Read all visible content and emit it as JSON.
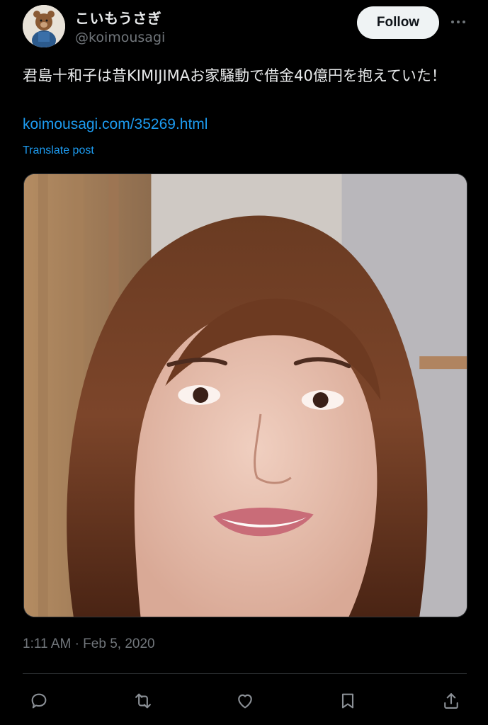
{
  "author": {
    "display_name": "こいもうさぎ",
    "handle": "@koimousagi"
  },
  "follow_label": "Follow",
  "post": {
    "text": "君島十和子は昔KIMIJIMAお家騒動で借金40億円を抱えていた！",
    "link": "koimousagi.com/35269.html",
    "translate_label": "Translate post"
  },
  "timestamp": "1:11 AM · Feb 5, 2020",
  "icons": {
    "more": "more-horizontal-icon",
    "reply": "reply-icon",
    "repost": "repost-icon",
    "like": "heart-icon",
    "bookmark": "bookmark-icon",
    "share": "share-icon"
  },
  "colors": {
    "background": "#000000",
    "text": "#e7e9ea",
    "secondary": "#71767b",
    "link": "#1d9bf0",
    "follow_bg": "#eff3f4"
  }
}
